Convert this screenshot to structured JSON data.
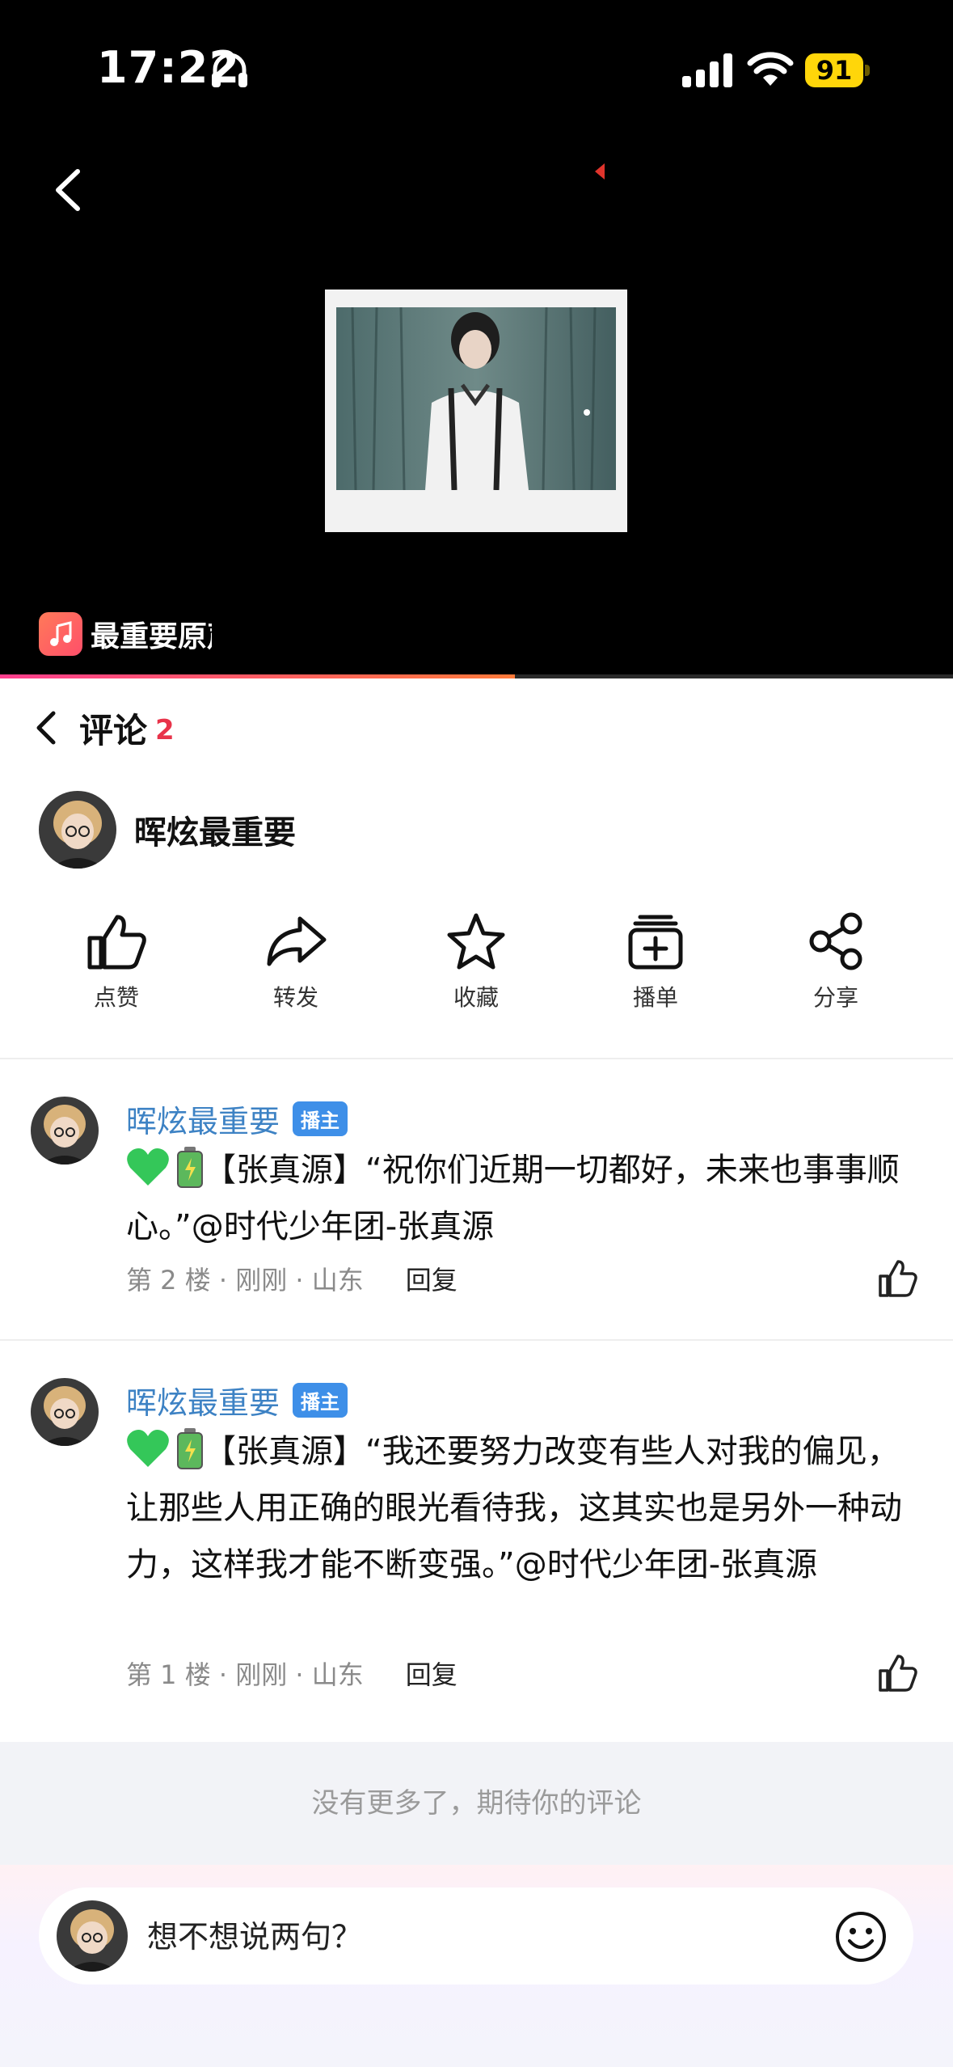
{
  "status_bar": {
    "time": "17:22",
    "battery": "91"
  },
  "player": {
    "music_title": "最重要原声",
    "progress": 0.54
  },
  "comments_header": {
    "title": "评论",
    "count": "2"
  },
  "author": {
    "name": "晖炫最重要"
  },
  "actions": [
    {
      "label": "点赞",
      "icon": "thumbs-up-icon"
    },
    {
      "label": "转发",
      "icon": "forward-icon"
    },
    {
      "label": "收藏",
      "icon": "star-icon"
    },
    {
      "label": "播单",
      "icon": "playlist-add-icon"
    },
    {
      "label": "分享",
      "icon": "share-icon"
    }
  ],
  "comments": [
    {
      "user": "晖炫最重要",
      "badge": "播主",
      "text": "【张真源】“祝你们近期一切都好，未来也事事顺心。”@时代少年团-张真源",
      "meta": "第 2 楼 · 刚刚 · 山东",
      "reply": "回复"
    },
    {
      "user": "晖炫最重要",
      "badge": "播主",
      "text": "【张真源】“我还要努力改变有些人对我的偏见，让那些人用正确的眼光看待我，这其实也是另外一种动力，这样我才能不断变强。”@时代少年团-张真源",
      "meta": "第 1 楼 · 刚刚 · 山东",
      "reply": "回复"
    }
  ],
  "no_more_text": "没有更多了，期待你的评论",
  "input": {
    "placeholder": "想不想说两句？"
  },
  "colors": {
    "accent_red": "#e8334a",
    "name_blue": "#3d82c4",
    "badge_blue": "#3e8fe8",
    "battery_yellow": "#ffd60a"
  }
}
